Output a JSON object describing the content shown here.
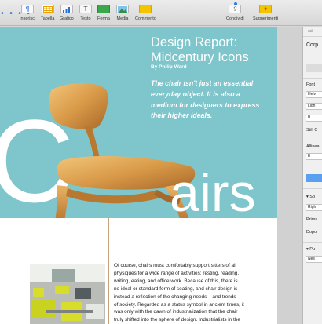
{
  "toolbar": {
    "items": [
      {
        "label": "Inserisci",
        "icon": "paragraph-icon"
      },
      {
        "label": "Tabella",
        "icon": "table-icon"
      },
      {
        "label": "Grafico",
        "icon": "chart-icon"
      },
      {
        "label": "Testo",
        "icon": "text-icon"
      },
      {
        "label": "Forma",
        "icon": "shape-icon"
      },
      {
        "label": "Media",
        "icon": "media-icon"
      },
      {
        "label": "Commento",
        "icon": "comment-icon"
      },
      {
        "label": "Condividi",
        "icon": "share-icon"
      },
      {
        "label": "Suggerimenti",
        "icon": "tips-icon"
      }
    ],
    "accent": "#2a7ae2"
  },
  "document": {
    "title_line1": "Design Report:",
    "title_line2": "Midcentury Icons",
    "byline": "By Philip Ward",
    "pullquote": [
      "The chair isn't just an essential",
      "everyday object. It is also a",
      "medium for designers to express",
      "their higher ideals."
    ],
    "hero_big_letter": "C",
    "hero_word": "airs",
    "hero_color": "#7ec5cc",
    "body": [
      "Of course, chairs must comfortably support sitters of all",
      "physiques for a wide range of activities: resting, reading,",
      "writing, eating, and office work. Because of this, there is",
      "no ideal or standard form of seating, and chair design is",
      "instead a reflection of the changing needs – and trends –",
      "of society. Regarded as a status symbol in ancient times, it",
      "was only with the dawn of industrialization that the chair",
      "truly shifted into the sphere of design. Industrialists in the"
    ]
  },
  "inspector": {
    "tab": "Stil",
    "header": "Corp",
    "font_label": "Font",
    "font_name": "Helv",
    "font_style": "Ligh",
    "bold_button": "B",
    "char_style": "Stili C",
    "align_label": "Allinea",
    "align_button": "E",
    "spacing_label": "Sp",
    "spacing_value": "Righ",
    "before_label": "Prima",
    "after_label": "Dopo",
    "bullets_label": "Pu",
    "bullets_value": "Nes"
  }
}
